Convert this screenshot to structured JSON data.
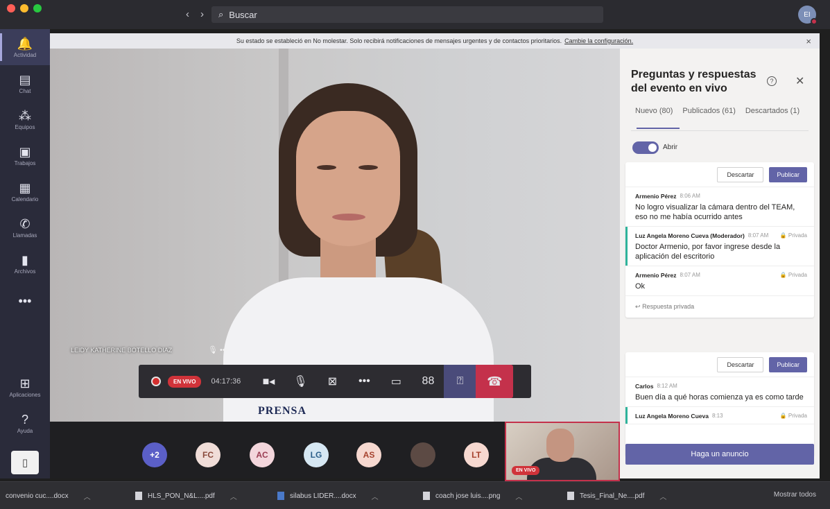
{
  "search": {
    "placeholder": "Buscar"
  },
  "user": {
    "initials": "EI"
  },
  "rail": [
    {
      "label": "Actividad",
      "icon": "bell-icon",
      "glyph": "🔔"
    },
    {
      "label": "Chat",
      "icon": "chat-icon",
      "glyph": "▤"
    },
    {
      "label": "Equipos",
      "icon": "teams-icon",
      "glyph": "⁂"
    },
    {
      "label": "Trabajos",
      "icon": "assignments-icon",
      "glyph": "▣"
    },
    {
      "label": "Calendario",
      "icon": "calendar-icon",
      "glyph": "▦"
    },
    {
      "label": "Llamadas",
      "icon": "phone-icon",
      "glyph": "✆"
    },
    {
      "label": "Archivos",
      "icon": "files-icon",
      "glyph": "▮"
    },
    {
      "label": "",
      "icon": "more-icon",
      "glyph": "•••"
    },
    {
      "label": "Aplicaciones",
      "icon": "apps-icon",
      "glyph": "⊞"
    },
    {
      "label": "Ayuda",
      "icon": "help-icon",
      "glyph": "?"
    }
  ],
  "notice": {
    "text": "Su estado se estableció en No molestar. Solo recibirá notificaciones de mensajes urgentes y de contactos prioritarios.",
    "link": "Cambie la configuración."
  },
  "speaker": {
    "name": "LEIDY KATHERINE BOTELLO DIAZ"
  },
  "shirt_text": "PRENSA",
  "call": {
    "live_label": "EN VIVO",
    "timer": "04:17:36"
  },
  "participants": [
    {
      "label": "+2",
      "bg": "#5b5fc7",
      "fg": "#ffffff"
    },
    {
      "label": "FC",
      "bg": "#f0ddd8",
      "fg": "#8a4a3c"
    },
    {
      "label": "AC",
      "bg": "#f3d6dc",
      "fg": "#9a3c52"
    },
    {
      "label": "LG",
      "bg": "#d6e7f3",
      "fg": "#2c5f8a"
    },
    {
      "label": "AS",
      "bg": "#f6d8d0",
      "fg": "#a6422e"
    },
    {
      "label": "",
      "bg": "#5c4a44",
      "fg": "#ffffff"
    },
    {
      "label": "LT",
      "bg": "#f6d8d0",
      "fg": "#a6422e"
    }
  ],
  "self_view": {
    "live_label": "EN VIVO"
  },
  "panel": {
    "title": "Preguntas y respuestas del evento en vivo",
    "tabs": [
      "Nuevo (80)",
      "Publicados (61)",
      "Descartados (1)"
    ],
    "toggle_label": "Abrir",
    "discard_label": "Descartar",
    "publish_label": "Publicar",
    "reply_label": "Respuesta privada",
    "announce_label": "Haga un anuncio",
    "private_label": "Privada",
    "card1": [
      {
        "author": "Armenio Pérez",
        "time": "8:06 AM",
        "private": false,
        "mod": false,
        "text": "No logro visualizar la cámara dentro del TEAM, eso no me había ocurrido antes"
      },
      {
        "author": "Luz Angela Moreno Cueva (Moderador)",
        "time": "8:07 AM",
        "private": true,
        "mod": true,
        "text": "Doctor Armenio, por favor ingrese desde la aplicación del escritorio"
      },
      {
        "author": "Armenio Pérez",
        "time": "8:07 AM",
        "private": true,
        "mod": false,
        "text": "Ok"
      }
    ],
    "card2": [
      {
        "author": "Carlos",
        "time": "8:12 AM",
        "private": false,
        "mod": false,
        "text": "Buen día a qué horas comienza ya es como tarde"
      },
      {
        "author": "Luz Angela Moreno Cueva",
        "time": "8:13",
        "private": true,
        "mod": true,
        "text": ""
      }
    ]
  },
  "downloads": [
    {
      "name": "convenio cuc....docx",
      "type": "doc"
    },
    {
      "name": "HLS_PON_N&L....pdf",
      "type": "file"
    },
    {
      "name": "silabus LIDER....docx",
      "type": "word"
    },
    {
      "name": "coach jose luis....png",
      "type": "file"
    },
    {
      "name": "Tesis_Final_Ne....pdf",
      "type": "file"
    }
  ],
  "show_all": "Mostrar todos",
  "colors": {
    "accent": "#6264a7",
    "live": "#d0333a",
    "hangup": "#c4314b",
    "moderator": "#2fb39b"
  }
}
